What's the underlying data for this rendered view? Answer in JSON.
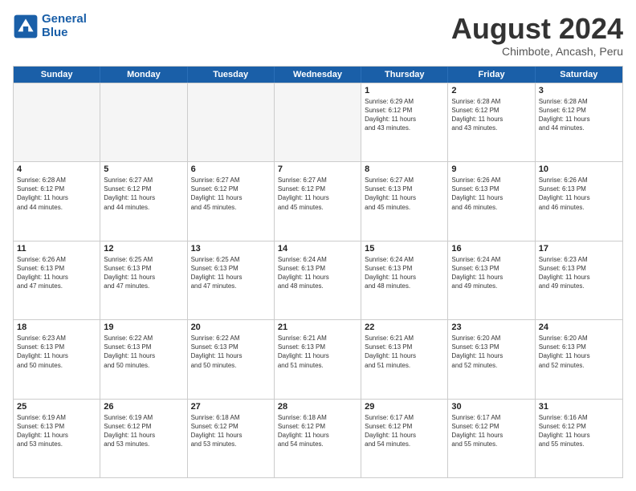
{
  "header": {
    "logo_line1": "General",
    "logo_line2": "Blue",
    "title": "August 2024",
    "subtitle": "Chimbote, Ancash, Peru"
  },
  "calendar": {
    "days": [
      "Sunday",
      "Monday",
      "Tuesday",
      "Wednesday",
      "Thursday",
      "Friday",
      "Saturday"
    ],
    "rows": [
      [
        {
          "day": "",
          "content": "",
          "empty": true
        },
        {
          "day": "",
          "content": "",
          "empty": true
        },
        {
          "day": "",
          "content": "",
          "empty": true
        },
        {
          "day": "",
          "content": "",
          "empty": true
        },
        {
          "day": "1",
          "content": "Sunrise: 6:29 AM\nSunset: 6:12 PM\nDaylight: 11 hours\nand 43 minutes.",
          "empty": false
        },
        {
          "day": "2",
          "content": "Sunrise: 6:28 AM\nSunset: 6:12 PM\nDaylight: 11 hours\nand 43 minutes.",
          "empty": false
        },
        {
          "day": "3",
          "content": "Sunrise: 6:28 AM\nSunset: 6:12 PM\nDaylight: 11 hours\nand 44 minutes.",
          "empty": false
        }
      ],
      [
        {
          "day": "4",
          "content": "Sunrise: 6:28 AM\nSunset: 6:12 PM\nDaylight: 11 hours\nand 44 minutes.",
          "empty": false
        },
        {
          "day": "5",
          "content": "Sunrise: 6:27 AM\nSunset: 6:12 PM\nDaylight: 11 hours\nand 44 minutes.",
          "empty": false
        },
        {
          "day": "6",
          "content": "Sunrise: 6:27 AM\nSunset: 6:12 PM\nDaylight: 11 hours\nand 45 minutes.",
          "empty": false
        },
        {
          "day": "7",
          "content": "Sunrise: 6:27 AM\nSunset: 6:12 PM\nDaylight: 11 hours\nand 45 minutes.",
          "empty": false
        },
        {
          "day": "8",
          "content": "Sunrise: 6:27 AM\nSunset: 6:13 PM\nDaylight: 11 hours\nand 45 minutes.",
          "empty": false
        },
        {
          "day": "9",
          "content": "Sunrise: 6:26 AM\nSunset: 6:13 PM\nDaylight: 11 hours\nand 46 minutes.",
          "empty": false
        },
        {
          "day": "10",
          "content": "Sunrise: 6:26 AM\nSunset: 6:13 PM\nDaylight: 11 hours\nand 46 minutes.",
          "empty": false
        }
      ],
      [
        {
          "day": "11",
          "content": "Sunrise: 6:26 AM\nSunset: 6:13 PM\nDaylight: 11 hours\nand 47 minutes.",
          "empty": false
        },
        {
          "day": "12",
          "content": "Sunrise: 6:25 AM\nSunset: 6:13 PM\nDaylight: 11 hours\nand 47 minutes.",
          "empty": false
        },
        {
          "day": "13",
          "content": "Sunrise: 6:25 AM\nSunset: 6:13 PM\nDaylight: 11 hours\nand 47 minutes.",
          "empty": false
        },
        {
          "day": "14",
          "content": "Sunrise: 6:24 AM\nSunset: 6:13 PM\nDaylight: 11 hours\nand 48 minutes.",
          "empty": false
        },
        {
          "day": "15",
          "content": "Sunrise: 6:24 AM\nSunset: 6:13 PM\nDaylight: 11 hours\nand 48 minutes.",
          "empty": false
        },
        {
          "day": "16",
          "content": "Sunrise: 6:24 AM\nSunset: 6:13 PM\nDaylight: 11 hours\nand 49 minutes.",
          "empty": false
        },
        {
          "day": "17",
          "content": "Sunrise: 6:23 AM\nSunset: 6:13 PM\nDaylight: 11 hours\nand 49 minutes.",
          "empty": false
        }
      ],
      [
        {
          "day": "18",
          "content": "Sunrise: 6:23 AM\nSunset: 6:13 PM\nDaylight: 11 hours\nand 50 minutes.",
          "empty": false
        },
        {
          "day": "19",
          "content": "Sunrise: 6:22 AM\nSunset: 6:13 PM\nDaylight: 11 hours\nand 50 minutes.",
          "empty": false
        },
        {
          "day": "20",
          "content": "Sunrise: 6:22 AM\nSunset: 6:13 PM\nDaylight: 11 hours\nand 50 minutes.",
          "empty": false
        },
        {
          "day": "21",
          "content": "Sunrise: 6:21 AM\nSunset: 6:13 PM\nDaylight: 11 hours\nand 51 minutes.",
          "empty": false
        },
        {
          "day": "22",
          "content": "Sunrise: 6:21 AM\nSunset: 6:13 PM\nDaylight: 11 hours\nand 51 minutes.",
          "empty": false
        },
        {
          "day": "23",
          "content": "Sunrise: 6:20 AM\nSunset: 6:13 PM\nDaylight: 11 hours\nand 52 minutes.",
          "empty": false
        },
        {
          "day": "24",
          "content": "Sunrise: 6:20 AM\nSunset: 6:13 PM\nDaylight: 11 hours\nand 52 minutes.",
          "empty": false
        }
      ],
      [
        {
          "day": "25",
          "content": "Sunrise: 6:19 AM\nSunset: 6:13 PM\nDaylight: 11 hours\nand 53 minutes.",
          "empty": false
        },
        {
          "day": "26",
          "content": "Sunrise: 6:19 AM\nSunset: 6:12 PM\nDaylight: 11 hours\nand 53 minutes.",
          "empty": false
        },
        {
          "day": "27",
          "content": "Sunrise: 6:18 AM\nSunset: 6:12 PM\nDaylight: 11 hours\nand 53 minutes.",
          "empty": false
        },
        {
          "day": "28",
          "content": "Sunrise: 6:18 AM\nSunset: 6:12 PM\nDaylight: 11 hours\nand 54 minutes.",
          "empty": false
        },
        {
          "day": "29",
          "content": "Sunrise: 6:17 AM\nSunset: 6:12 PM\nDaylight: 11 hours\nand 54 minutes.",
          "empty": false
        },
        {
          "day": "30",
          "content": "Sunrise: 6:17 AM\nSunset: 6:12 PM\nDaylight: 11 hours\nand 55 minutes.",
          "empty": false
        },
        {
          "day": "31",
          "content": "Sunrise: 6:16 AM\nSunset: 6:12 PM\nDaylight: 11 hours\nand 55 minutes.",
          "empty": false
        }
      ]
    ]
  }
}
